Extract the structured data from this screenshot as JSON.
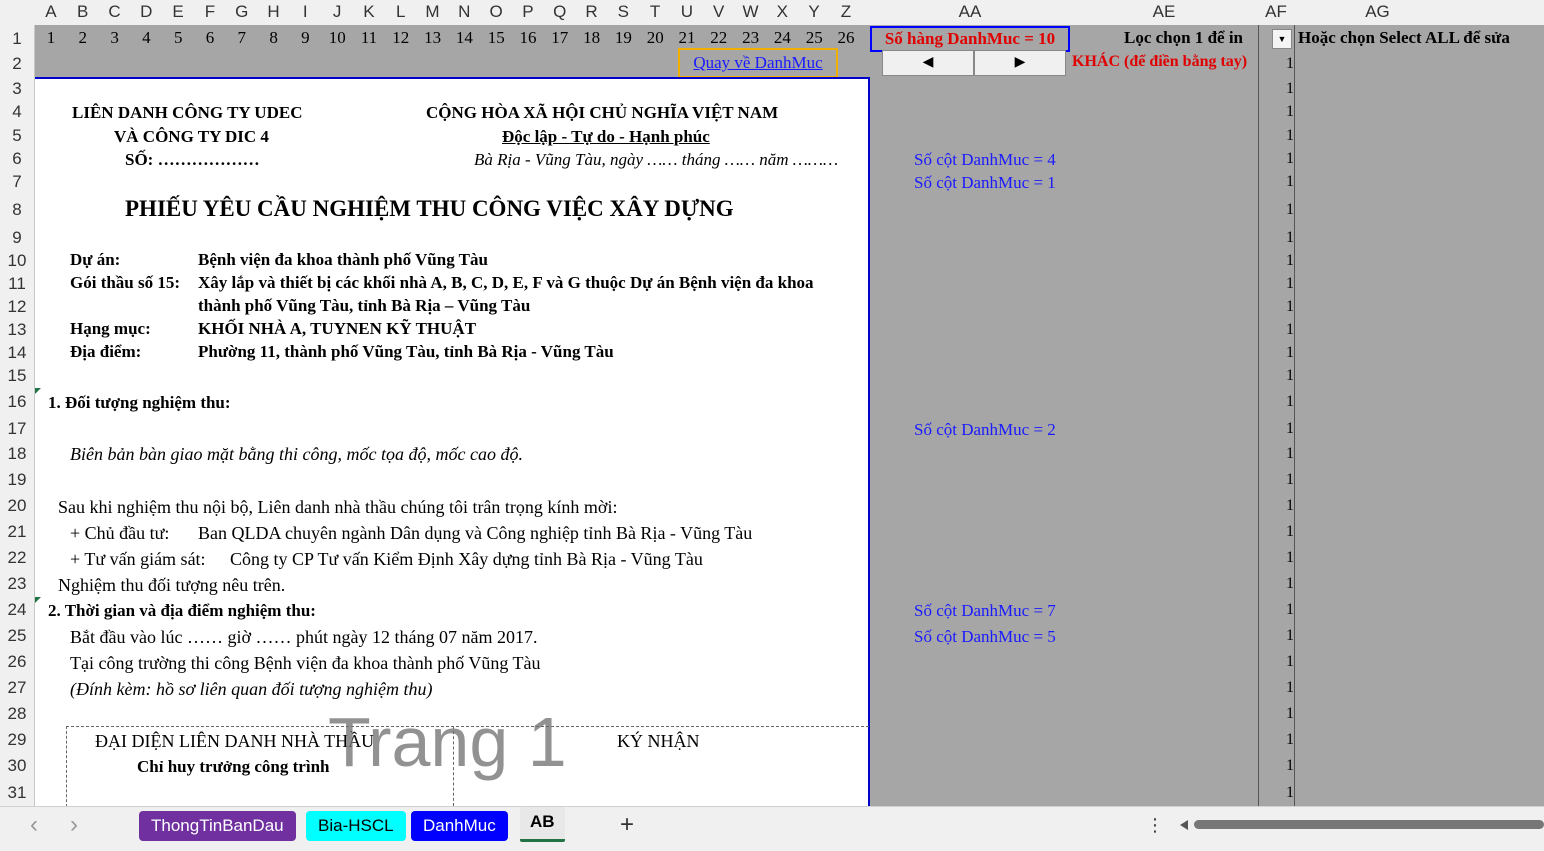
{
  "column_headers": [
    "A",
    "B",
    "C",
    "D",
    "E",
    "F",
    "G",
    "H",
    "I",
    "J",
    "K",
    "L",
    "M",
    "N",
    "O",
    "P",
    "Q",
    "R",
    "S",
    "T",
    "U",
    "V",
    "W",
    "X",
    "Y",
    "Z",
    "AA",
    "AE",
    "AF",
    "AG"
  ],
  "row_numbers": [
    "1",
    "2",
    "3",
    "4",
    "5",
    "6",
    "7",
    "8",
    "9",
    "10",
    "11",
    "12",
    "13",
    "14",
    "15",
    "16",
    "17",
    "18",
    "19",
    "20",
    "21",
    "22",
    "23",
    "24",
    "25",
    "26",
    "27",
    "28",
    "29",
    "30",
    "31"
  ],
  "row1_numbers": [
    "1",
    "2",
    "3",
    "4",
    "5",
    "6",
    "7",
    "8",
    "9",
    "10",
    "11",
    "12",
    "13",
    "14",
    "15",
    "16",
    "17",
    "18",
    "19",
    "20",
    "21",
    "22",
    "23",
    "24",
    "25",
    "26"
  ],
  "controls": {
    "so_hang": "Số hàng DanhMuc = 10",
    "loc_chon": "Lọc chọn 1 để in",
    "hoac_chon": "Hoặc chọn Select ALL để sửa",
    "quay_ve": "Quay về DanhMuc",
    "khac": "KHÁC (để điền bằng tay)",
    "prev_arrow": "◀",
    "next_arrow": "▶",
    "dropdown_arrow": "▼"
  },
  "af_values": [
    "1",
    "1",
    "1",
    "1",
    "1",
    "1",
    "1",
    "1",
    "1",
    "1",
    "1",
    "1",
    "1",
    "1",
    "1",
    "1",
    "1",
    "1",
    "1",
    "1",
    "1",
    "1",
    "1",
    "1",
    "1",
    "1",
    "1",
    "1",
    "1",
    "1"
  ],
  "notes": {
    "n6": "Số cột DanhMuc = 4",
    "n7": "Số cột DanhMuc = 1",
    "n17": "Số cột DanhMuc = 2",
    "n24": "Số cột DanhMuc = 7",
    "n25": "Số cột DanhMuc = 5"
  },
  "doc": {
    "company1": "LIÊN DANH CÔNG TY UDEC",
    "company2": "VÀ CÔNG TY DIC 4",
    "so": "SỐ: ………………",
    "republic": "CỘNG HÒA XÃ HỘI CHỦ NGHĨA VIỆT NAM",
    "motto": "Độc lập - Tự do - Hạnh phúc",
    "place_date": "Bà Rịa - Vũng Tàu, ngày …… tháng …… năm ………",
    "title": "PHIẾU YÊU CẦU NGHIỆM THU CÔNG VIỆC XÂY DỰNG",
    "du_an_label": "Dự án:",
    "du_an_value": "Bệnh viện đa khoa thành phố Vũng Tàu",
    "goi_thau_label": "Gói thầu số 15:",
    "goi_thau_value1": "Xây lắp và thiết bị các khối nhà A, B, C, D, E, F và G thuộc Dự án Bệnh viện đa khoa",
    "goi_thau_value2": "thành phố Vũng Tàu, tỉnh Bà Rịa – Vũng Tàu",
    "hang_muc_label": "Hạng mục:",
    "hang_muc_value": "KHỐI NHÀ A, TUYNEN KỸ THUẬT",
    "dia_diem_label": "Địa điểm:",
    "dia_diem_value": "Phường 11, thành phố Vũng Tàu, tỉnh Bà Rịa - Vũng Tàu",
    "sec1": "1. Đối tượng nghiệm thu:",
    "sec1_text": "Biên bản bàn giao mặt bằng thi công, mốc tọa độ, mốc cao độ.",
    "invite": "Sau khi nghiệm thu nội bộ, Liên danh nhà thầu chúng tôi trân trọng kính mời:",
    "cdt_label": "+ Chủ đầu tư:",
    "cdt_value": "Ban QLDA chuyên ngành Dân dụng và Công nghiệp tỉnh Bà Rịa - Vũng Tàu",
    "tvgs_label": "+ Tư vấn giám sát:",
    "tvgs_value": "Công ty CP Tư vấn Kiểm Định Xây dựng tỉnh Bà Rịa - Vũng Tàu",
    "nghiem_thu": "Nghiệm thu đối tượng nêu trên.",
    "sec2": "2. Thời gian và địa điểm nghiệm thu:",
    "bat_dau": "Bắt đầu vào lúc …… giờ …… phút ngày 12 tháng 07 năm 2017.",
    "tai_cong_truong": "Tại công trường thi công Bệnh viện đa khoa thành phố Vũng Tàu",
    "dinh_kem": "(Đính kèm: hồ sơ liên quan đối tượng nghiệm thu)",
    "dai_dien": "ĐẠI DIỆN LIÊN DANH NHÀ THẦU",
    "chi_huy": "Chỉ huy trưởng công trình",
    "ky_nhan": "KÝ NHẬN",
    "watermark": "Trang 1"
  },
  "tabs": [
    {
      "label": "ThongTinBanDau",
      "bg": "#7030a0",
      "fg": "#ffffff"
    },
    {
      "label": "Bia-HSCL",
      "bg": "#00ffff",
      "fg": "#000000"
    },
    {
      "label": "DanhMuc",
      "bg": "#0000ff",
      "fg": "#ffffff"
    },
    {
      "label": "AB",
      "bg": "#e8e8e8",
      "fg": "#000000"
    }
  ],
  "statusbar": {
    "prev": "‹",
    "next": "›",
    "add": "+",
    "more": "⋮"
  }
}
